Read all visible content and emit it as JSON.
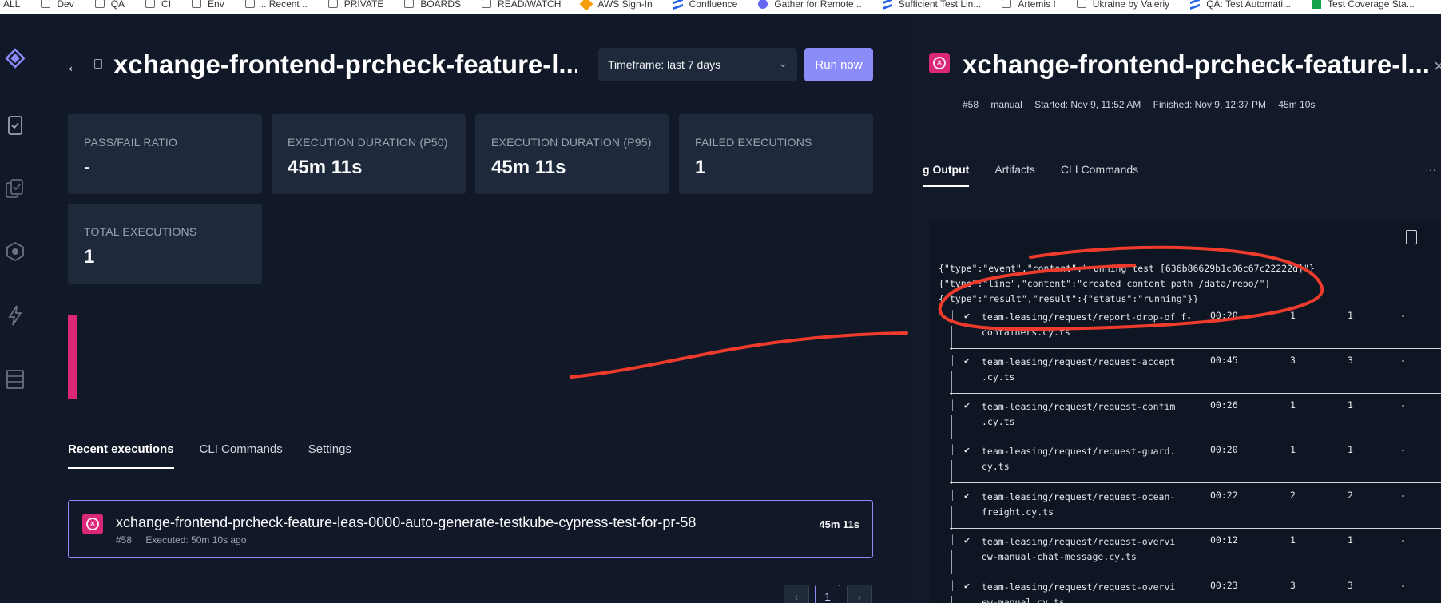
{
  "bookmarks": [
    {
      "label": "ALL",
      "icon": "none"
    },
    {
      "label": "Dev",
      "icon": "folder-icon"
    },
    {
      "label": "QA",
      "icon": "folder-icon"
    },
    {
      "label": "CI",
      "icon": "folder-icon"
    },
    {
      "label": "Env",
      "icon": "folder-icon"
    },
    {
      "label": ".. Recent ..",
      "icon": "folder-icon"
    },
    {
      "label": "PRIVATE",
      "icon": "folder-icon"
    },
    {
      "label": "BOARDS",
      "icon": "folder-icon"
    },
    {
      "label": "READ/WATCH",
      "icon": "folder-icon"
    },
    {
      "label": "AWS Sign-In",
      "icon": "aws-icon"
    },
    {
      "label": "Confluence",
      "icon": "confluence-icon"
    },
    {
      "label": "Gather for Remote...",
      "icon": "gather-icon"
    },
    {
      "label": "Sufficient Test Lin...",
      "icon": "confluence-icon"
    },
    {
      "label": "Artemis I",
      "icon": "folder-icon"
    },
    {
      "label": "Ukraine by Valeriy",
      "icon": "folder-icon"
    },
    {
      "label": "QA: Test Automati...",
      "icon": "confluence-icon"
    },
    {
      "label": "Test Coverage Sta...",
      "icon": "sheets-icon"
    }
  ],
  "header": {
    "title": "xchange-frontend-prcheck-feature-l...",
    "timeframe": "Timeframe: last 7 days",
    "run_now": "Run now"
  },
  "metrics": [
    {
      "label": "PASS/FAIL RATIO",
      "value": "-"
    },
    {
      "label": "EXECUTION DURATION (P50)",
      "value": "45m 11s"
    },
    {
      "label": "EXECUTION DURATION (P95)",
      "value": "45m 11s"
    },
    {
      "label": "FAILED EXECUTIONS",
      "value": "1"
    },
    {
      "label": "TOTAL EXECUTIONS",
      "value": "1"
    }
  ],
  "tabs": [
    "Recent executions",
    "CLI Commands",
    "Settings"
  ],
  "execution": {
    "name": "xchange-frontend-prcheck-feature-leas-0000-auto-generate-testkube-cypress-test-for-pr-58",
    "number": "#58",
    "executed": "Executed: 50m 10s ago",
    "duration": "45m 11s"
  },
  "pagination": {
    "prev": "‹",
    "current": "1",
    "next": "›"
  },
  "panel": {
    "title": "xchange-frontend-prcheck-feature-l...",
    "number": "#58",
    "trigger": "manual",
    "started": "Started: Nov 9, 11:52 AM",
    "finished": "Finished: Nov 9, 12:37 PM",
    "duration": "45m 10s",
    "tabs": [
      "g Output",
      "Artifacts",
      "CLI Commands"
    ],
    "more": "···"
  },
  "log": {
    "lines": [
      "{\"type\":\"event\",\"content\":\"running test [636b86629b1c06c67c22222d]\"}",
      "{\"type\":\"line\",\"content\":\"created content path /data/repo/\"}",
      "{\"type\":\"result\",\"result\":{\"status\":\"running\"}}"
    ],
    "rows": [
      {
        "spec": "team-leasing/request/report-drop-of f-containers.cy.ts",
        "dur": "00:20",
        "tests": "1",
        "pass": "1",
        "fail": "-"
      },
      {
        "spec": "team-leasing/request/request-accept .cy.ts",
        "dur": "00:45",
        "tests": "3",
        "pass": "3",
        "fail": "-"
      },
      {
        "spec": "team-leasing/request/request-confim .cy.ts",
        "dur": "00:26",
        "tests": "1",
        "pass": "1",
        "fail": "-"
      },
      {
        "spec": "team-leasing/request/request-guard. cy.ts",
        "dur": "00:20",
        "tests": "1",
        "pass": "1",
        "fail": "-"
      },
      {
        "spec": "team-leasing/request/request-ocean- freight.cy.ts",
        "dur": "00:22",
        "tests": "2",
        "pass": "2",
        "fail": "-"
      },
      {
        "spec": "team-leasing/request/request-overvi ew-manual-chat-message.cy.ts",
        "dur": "00:12",
        "tests": "1",
        "pass": "1",
        "fail": "-"
      },
      {
        "spec": "team-leasing/request/request-overvi ew-manual.cy.ts",
        "dur": "00:23",
        "tests": "3",
        "pass": "3",
        "fail": "-"
      }
    ],
    "check": "✔",
    "pipe": "│"
  },
  "colors": {
    "accent": "#8b8cf9",
    "fail": "#db2777",
    "annotation": "#ef3b2c"
  }
}
